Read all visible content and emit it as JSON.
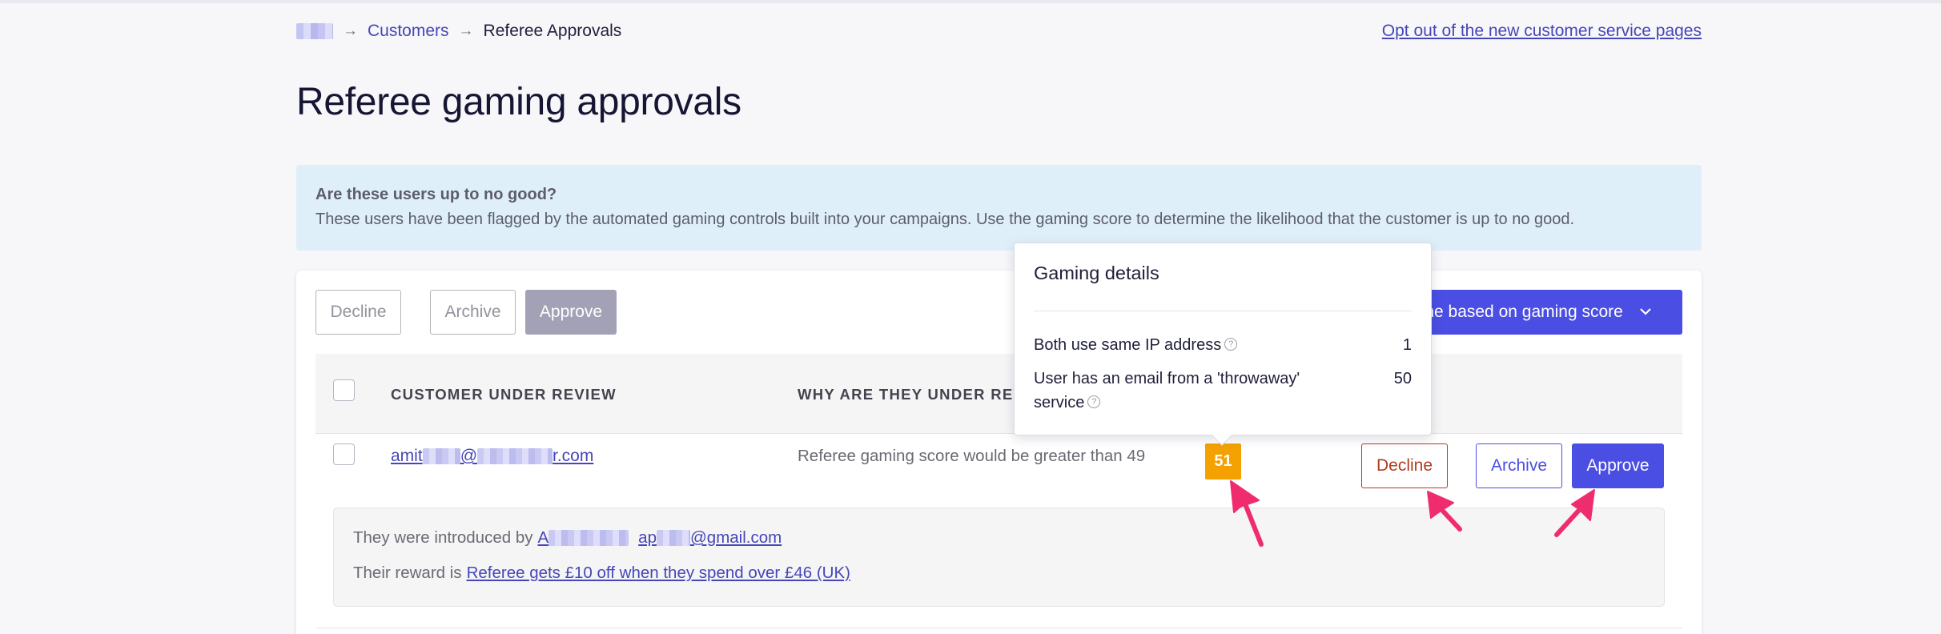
{
  "breadcrumb": {
    "customers": "Customers",
    "current": "Referee Approvals"
  },
  "optout_link": "Opt out of the new customer service pages",
  "page_title": "Referee gaming approvals",
  "banner": {
    "title": "Are these users up to no good?",
    "text": "These users have been flagged by the automated gaming controls built into your campaigns. Use the gaming score to determine the likelihood that the customer is up to no good."
  },
  "toolbar": {
    "decline_label": "Decline",
    "archive_label": "Archive",
    "approve_label": "Approve",
    "dropdown_label": "line based on gaming score"
  },
  "table": {
    "headers": {
      "customer": "CUSTOMER UNDER REVIEW",
      "reason": "WHY ARE THEY UNDER REVIEW"
    },
    "rows": [
      {
        "email_start": "amit",
        "email_at": "@",
        "email_end": "r.com",
        "reason": "Referee gaming score would be greater than 49",
        "score": "51",
        "decline_label": "Decline",
        "archive_label": "Archive",
        "approve_label": "Approve",
        "introduced_prefix": "They were introduced by",
        "introduced_start": "A",
        "introduced_mid": "ap",
        "introduced_end": "@gmail.com",
        "reward_prefix": "Their reward is",
        "reward_link": "Referee gets £10 off when they spend over £46 (UK)"
      }
    ]
  },
  "popover": {
    "title": "Gaming details",
    "rows": [
      {
        "label": "Both use same IP address",
        "value": "1"
      },
      {
        "label": "User has an email from a 'throwaway' service",
        "value": "50"
      }
    ]
  },
  "colors": {
    "accent": "#4a4ee3",
    "score_badge": "#f5a102",
    "decline": "#b23c23",
    "annotation_arrow": "#ef2d6e"
  },
  "icons": {
    "breadcrumb_separator": "arrow-right-icon",
    "dropdown_chevron": "chevron-down-icon",
    "info": "info-icon"
  }
}
